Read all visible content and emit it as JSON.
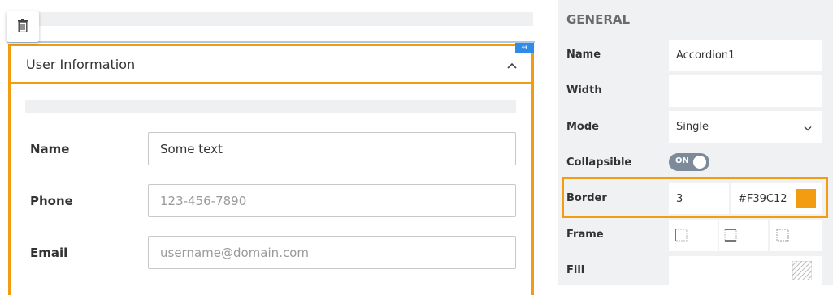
{
  "accordion": {
    "title": "User Information",
    "border_color": "#F39C12",
    "fields": [
      {
        "label": "Name",
        "value": "Some text",
        "placeholder": ""
      },
      {
        "label": "Phone",
        "value": "",
        "placeholder": "123-456-7890"
      },
      {
        "label": "Email",
        "value": "",
        "placeholder": "username@domain.com"
      }
    ]
  },
  "properties": {
    "section_title": "GENERAL",
    "name_label": "Name",
    "name_value": "Accordion1",
    "width_label": "Width",
    "width_value": "",
    "mode_label": "Mode",
    "mode_value": "Single",
    "collapsible_label": "Collapsible",
    "collapsible_state": "ON",
    "border_label": "Border",
    "border_width": "3",
    "border_color_hex": "#F39C12",
    "frame_label": "Frame",
    "fill_label": "Fill"
  },
  "icons": {
    "delete": "trash-icon",
    "collapse": "chevron-up-icon",
    "resize": "resize-horizontal-icon",
    "dropdown": "chevron-down-icon"
  },
  "colors": {
    "accent": "#F39C12",
    "selection": "#2f8be6",
    "panel_bg": "#f0f1f3"
  }
}
